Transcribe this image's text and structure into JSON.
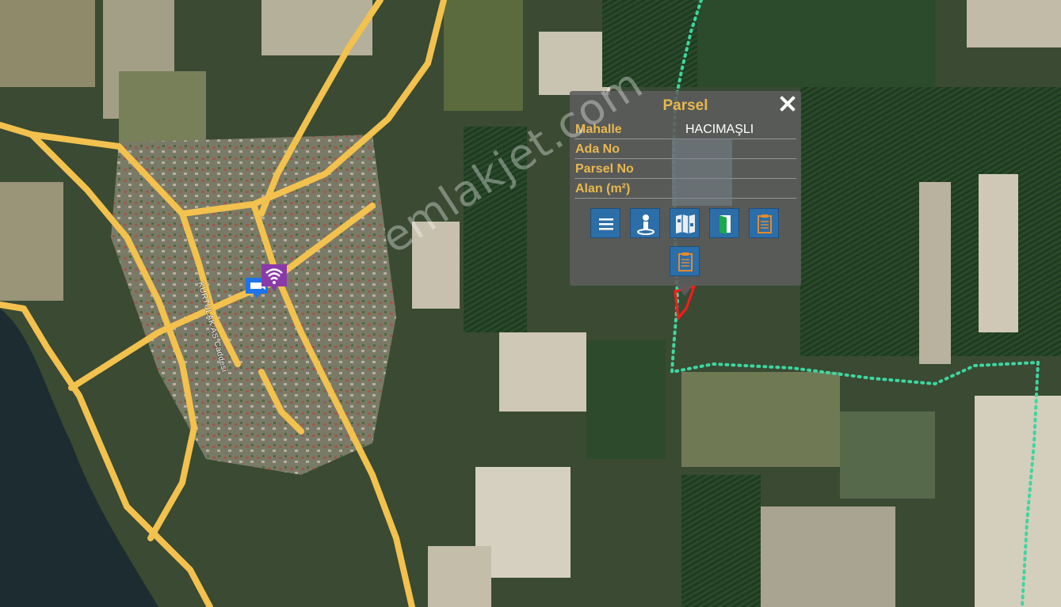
{
  "popup": {
    "title": "Parsel",
    "close_icon": "close-icon",
    "rows": [
      {
        "label": "Mahalle",
        "value": "HACIMAŞLI"
      },
      {
        "label": "Ada No",
        "value": ""
      },
      {
        "label": "Parsel No",
        "value": ""
      },
      {
        "label": "Alan (m²)",
        "value": ""
      }
    ],
    "tool_icons": [
      "menu-icon",
      "person-info-icon",
      "map-sheet-icon",
      "door-exit-icon",
      "report-icon",
      "report-icon"
    ]
  },
  "map": {
    "street_label": "KURTULAK AS Caddesi",
    "poi_icons": [
      "wifi-icon",
      "camera-icon"
    ],
    "colors": {
      "road": "#f2c14e",
      "boundary": "#3ed6a0",
      "parcel": "#ff1a1a",
      "popup_label": "#e8b850",
      "tool_button": "#2c6ea8"
    }
  },
  "watermark": "emlakjet.com"
}
